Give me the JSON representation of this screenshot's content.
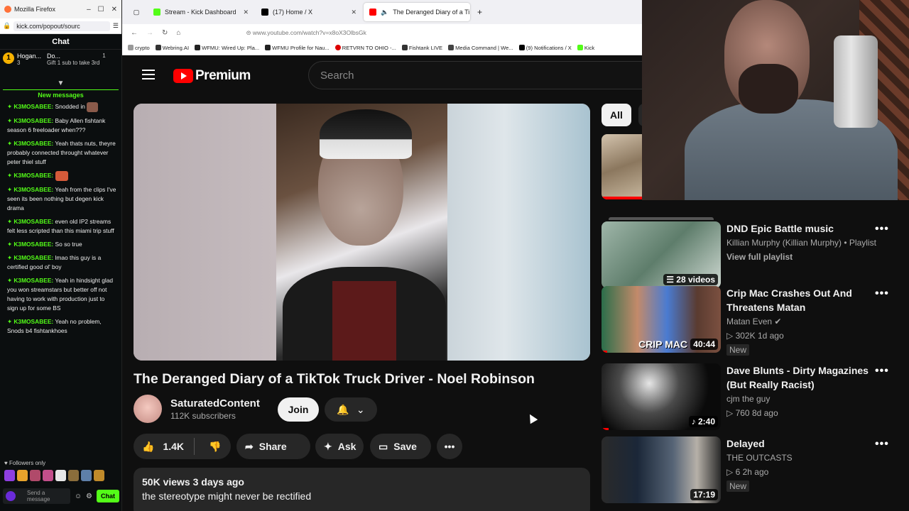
{
  "kick_window": {
    "title": "Mozilla Firefox",
    "url": "kick.com/popout/sourc",
    "header": "Chat",
    "gifters": [
      {
        "rank": "1",
        "name": "Hogan...",
        "count": "3"
      },
      {
        "rank": "",
        "name": "Do...",
        "count": "1",
        "sub": "Gift 1 sub to take 3rd"
      }
    ],
    "new_messages_label": "New messages",
    "messages": [
      {
        "user": "K3MOSABEE:",
        "text": "Snodded in"
      },
      {
        "user": "K3MOSABEE:",
        "text": "Baby Allen fishtank season 6 freeloader when???"
      },
      {
        "user": "K3MOSABEE:",
        "text": "Yeah thats nuts, theyre probably connected throught whatever peter thiel stuff"
      },
      {
        "user": "K3MOSABEE:",
        "text": ""
      },
      {
        "user": "K3MOSABEE:",
        "text": "Yeah from the clips I've seen its been nothing but degen kick drama"
      },
      {
        "user": "K3MOSABEE:",
        "text": "even old IP2 streams felt less scripted than this miami trip stuff"
      },
      {
        "user": "K3MOSABEE:",
        "text": "So so true"
      },
      {
        "user": "K3MOSABEE:",
        "text": "lmao this guy is a certified good ol' boy"
      },
      {
        "user": "K3MOSABEE:",
        "text": "Yeah in hindsight glad you won streamstars but better off not having to work with production just to sign up for some BS"
      },
      {
        "user": "K3MOSABEE:",
        "text": "Yeah no problem, Snods b4 fishtankhoes"
      }
    ],
    "followers_only": "Followers only",
    "input_placeholder": "Send a message",
    "send_label": "Chat"
  },
  "browser": {
    "tabs": [
      {
        "label": "Stream - Kick Dashboard",
        "color": "#53fc18"
      },
      {
        "label": "(17) Home / X",
        "color": "#000000"
      },
      {
        "label": "The Deranged Diary of a Ti",
        "color": "#ff0000",
        "active": true
      }
    ],
    "address": "www.youtube.com/watch?v=x8oX3OlbsGk",
    "bookmarks": [
      "crypto",
      "Webring.AI",
      "WFMU: Wired Up: Pla...",
      "WFMU Profile for Nau...",
      "RETVRN TO OHIO -...",
      "Fishtank LIVE",
      "Media Command | We...",
      "(9) Notifications / X",
      "Kick"
    ]
  },
  "youtube": {
    "logo_text": "Premium",
    "search_placeholder": "Search",
    "video_title": "The Deranged Diary of a TikTok Truck Driver - Noel Robinson",
    "channel_name": "SaturatedContent",
    "subscribers": "112K subscribers",
    "join_label": "Join",
    "likes": "1.4K",
    "share_label": "Share",
    "ask_label": "Ask",
    "save_label": "Save",
    "views": "50K views",
    "age": "3 days ago",
    "description": "the stereotype might never be rectified",
    "chips": [
      "All"
    ],
    "recommendations": [
      {
        "title": "DND Epic Battle music",
        "channel": "Killian Murphy (Killian Murphy) • Playlist",
        "extra": "View full playlist",
        "duration": "28 videos"
      },
      {
        "title": "Crip Mac Crashes Out And Threatens Matan",
        "channel": "Matan Even",
        "views": "302K",
        "age": "1d ago",
        "badge": "New",
        "duration": "40:44",
        "thumb_text": "CRIP MAC",
        "progress": 0.05
      },
      {
        "title": "Dave Blunts - Dirty Magazines (But Really Racist)",
        "channel": "cjm the guy",
        "views": "760",
        "age": "8d ago",
        "duration": "2:40",
        "progress": 0.06
      },
      {
        "title": "Delayed",
        "channel": "THE OUTCASTS",
        "views": "6",
        "age": "2h ago",
        "badge": "New",
        "duration": "17:19"
      }
    ]
  }
}
